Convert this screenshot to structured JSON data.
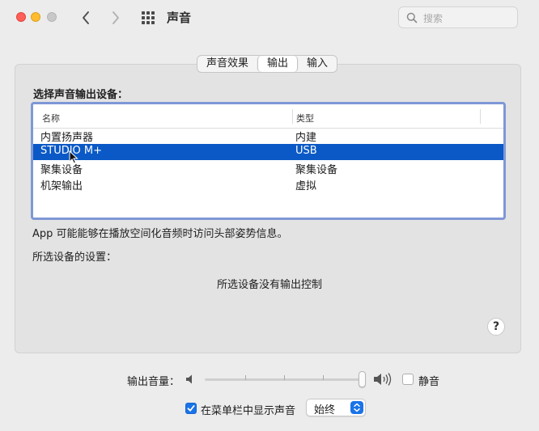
{
  "window": {
    "title": "声音"
  },
  "search": {
    "placeholder": "搜索"
  },
  "tabs": [
    {
      "label": "声音效果",
      "selected": false
    },
    {
      "label": "输出",
      "selected": true
    },
    {
      "label": "输入",
      "selected": false
    }
  ],
  "output": {
    "section_label": "选择声音输出设备：",
    "columns": {
      "name": "名称",
      "type": "类型"
    },
    "devices": [
      {
        "name": "内置扬声器",
        "type": "内建",
        "selected": false
      },
      {
        "name": "STUDIO M+",
        "type": "USB",
        "selected": true
      },
      {
        "name": "聚集设备",
        "type": "聚集设备",
        "selected": false
      },
      {
        "name": "机架输出",
        "type": "虚拟",
        "selected": false
      }
    ],
    "info_text": "App 可能能够在播放空间化音频时访问头部姿势信息。",
    "settings_label": "所选设备的设置：",
    "no_control_text": "所选设备没有输出控制"
  },
  "help": {
    "label": "?"
  },
  "volume": {
    "label": "输出音量：",
    "level": 1.0,
    "mute_label": "静音",
    "muted": false
  },
  "menu_bar": {
    "label": "在菜单栏中显示声音",
    "checked": true,
    "option": "始终"
  },
  "colors": {
    "selection": "#0a59c6",
    "focus_ring": "#7f97d6",
    "accent": "#1a73e8"
  }
}
